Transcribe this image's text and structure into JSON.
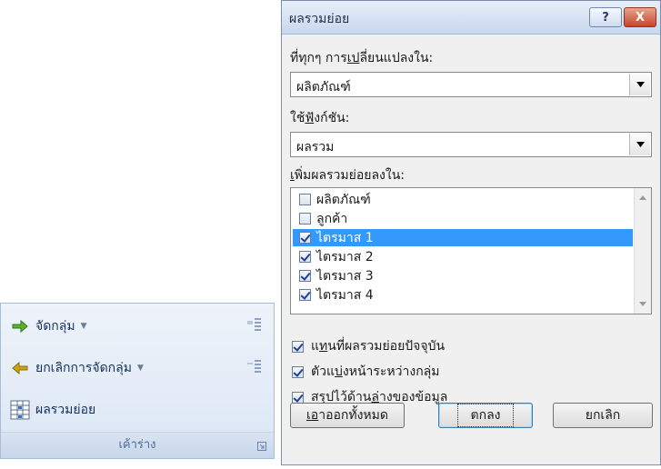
{
  "ribbon": {
    "group_button": "จัดกลุ่ม",
    "ungroup_button": "ยกเลิกการจัดกลุ่ม",
    "subtotal_button": "ผลรวมย่อย",
    "caption": "เค้าร่าง"
  },
  "dialog": {
    "title": "ผลรวมย่อย",
    "help_label": "?",
    "close_label": "X",
    "change_label_pre": "ที่ทุกๆ การ",
    "change_label_u": "เป",
    "change_label_post": "ลี่ยนแปลงใน:",
    "change_value": "ผลิตภัณฑ์",
    "function_label_pre": "ใช้",
    "function_label_u": "ฟั",
    "function_label_post": "งก์ชัน:",
    "function_value": "ผลรวม",
    "add_label_pre": "",
    "add_label_u": "เ",
    "add_label_post": "พิ่มผลรวมย่อยลงใน:",
    "list_items": [
      {
        "label": "ผลิตภัณฑ์",
        "checked": false,
        "selected": false
      },
      {
        "label": "ลูกค้า",
        "checked": false,
        "selected": false
      },
      {
        "label": "ไตรมาส 1",
        "checked": true,
        "selected": true
      },
      {
        "label": "ไตรมาส 2",
        "checked": true,
        "selected": false
      },
      {
        "label": "ไตรมาส 3",
        "checked": true,
        "selected": false
      },
      {
        "label": "ไตรมาส 4",
        "checked": true,
        "selected": false
      }
    ],
    "options": {
      "replace_pre": "แ",
      "replace_u": "ท",
      "replace_post": "นที่ผลรวมย่อยปัจจุบัน",
      "pagebreak_pre": "ตัวแ",
      "pagebreak_u": "บ่",
      "pagebreak_post": "งหน้าระหว่างกลุ่ม",
      "summary_pre": "สรุปไว้ด้าน",
      "summary_u": "ล่",
      "summary_post": "างของข้อมูล"
    },
    "buttons": {
      "remove_all_u": "เอ",
      "remove_all_post": "าออกทั้งหมด",
      "ok": "ตกลง",
      "cancel": "ยกเลิก"
    }
  },
  "colors": {
    "selection": "#3399ff",
    "ribbon_text": "#15315a",
    "group_arrow": "#58b130",
    "ungroup_arrow": "#c9a516"
  }
}
